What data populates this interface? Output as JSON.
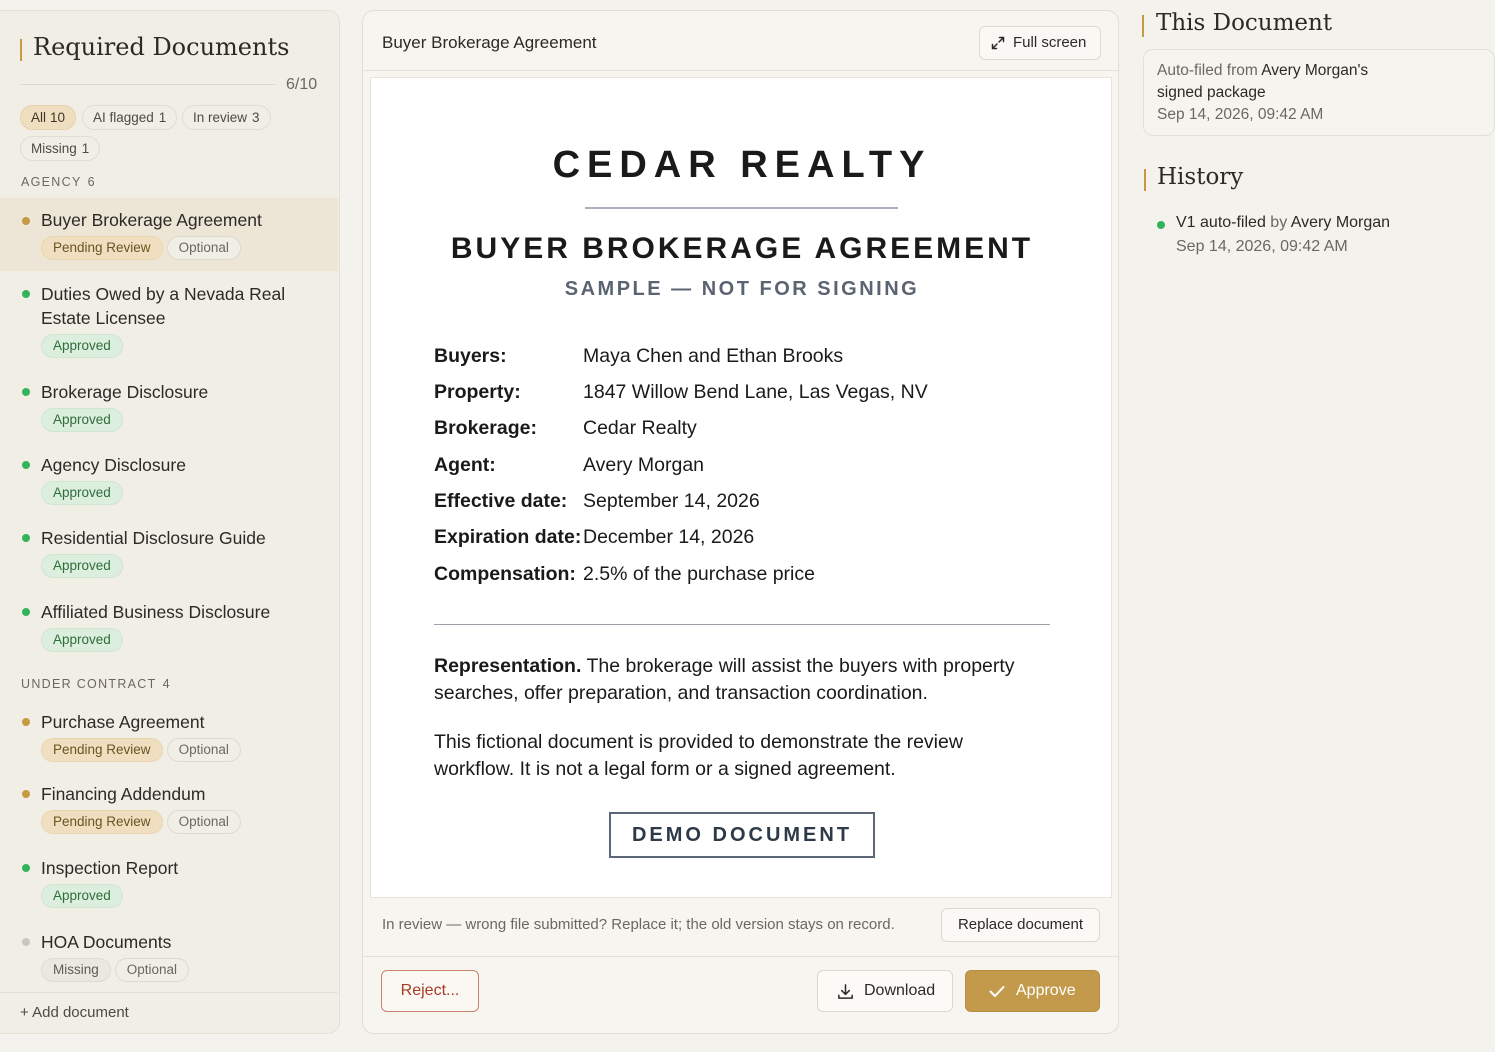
{
  "sidebar": {
    "title": "Required Documents",
    "count": "6/10",
    "filters": [
      {
        "label": "All",
        "count": "10"
      },
      {
        "label": "AI flagged",
        "count": "1"
      },
      {
        "label": "In review",
        "count": "3"
      },
      {
        "label": "Missing",
        "count": "1"
      }
    ],
    "groups": [
      {
        "label": "AGENCY",
        "count": "6"
      },
      {
        "label": "UNDER CONTRACT",
        "count": "4"
      }
    ],
    "docs": [
      {
        "title": "Buyer Brokerage Agreement",
        "status": "pending",
        "badges": [
          "Pending Review",
          "Optional"
        ]
      },
      {
        "title": "Duties Owed by a Nevada Real Estate Licensee",
        "status": "approved",
        "badges": [
          "Approved"
        ]
      },
      {
        "title": "Brokerage Disclosure",
        "status": "approved",
        "badges": [
          "Approved"
        ]
      },
      {
        "title": "Agency Disclosure",
        "status": "approved",
        "badges": [
          "Approved"
        ]
      },
      {
        "title": "Residential Disclosure Guide",
        "status": "approved",
        "badges": [
          "Approved"
        ]
      },
      {
        "title": "Affiliated Business Disclosure",
        "status": "approved",
        "badges": [
          "Approved"
        ]
      },
      {
        "title": "Purchase Agreement",
        "status": "pending",
        "badges": [
          "Pending Review",
          "Optional"
        ]
      },
      {
        "title": "Financing Addendum",
        "status": "pending",
        "badges": [
          "Pending Review",
          "Optional"
        ]
      },
      {
        "title": "Inspection Report",
        "status": "approved",
        "badges": [
          "Approved"
        ]
      },
      {
        "title": "HOA Documents",
        "status": "missing",
        "badges": [
          "Missing",
          "Optional"
        ]
      }
    ],
    "add_label": "+ Add document"
  },
  "viewer": {
    "title": "Buyer Brokerage Agreement",
    "fullscreen_label": "Full screen",
    "review_note": "In review — wrong file submitted? Replace it; the old version stays on record.",
    "replace_label": "Replace document",
    "reject_label": "Reject...",
    "download_label": "Download",
    "approve_label": "Approve"
  },
  "document": {
    "brand": "CEDAR REALTY",
    "title": "BUYER BROKERAGE AGREEMENT",
    "subtitle": "SAMPLE — NOT FOR SIGNING",
    "fields": [
      {
        "label": "Buyers:",
        "value": "Maya Chen and Ethan Brooks"
      },
      {
        "label": "Property:",
        "value": "1847 Willow Bend Lane, Las Vegas, NV"
      },
      {
        "label": "Brokerage:",
        "value": "Cedar Realty"
      },
      {
        "label": "Agent:",
        "value": "Avery Morgan"
      },
      {
        "label": "Effective date:",
        "value": "September 14, 2026"
      },
      {
        "label": "Expiration date:",
        "value": "December 14, 2026"
      },
      {
        "label": "Compensation:",
        "value": "2.5% of the purchase price"
      }
    ],
    "representation_label": "Representation.",
    "representation_text": "The brokerage will assist the buyers with property searches, offer preparation, and transaction coordination.",
    "disclaimer": "This fictional document is provided to demonstrate the review workflow. It is not a legal form or a signed agreement.",
    "stamp": "DEMO DOCUMENT"
  },
  "details": {
    "heading": "This Document",
    "source_prefix": "Auto-filed from",
    "source_name": "Avery Morgan's",
    "source_suffix": "signed package",
    "timestamp": "Sep 14, 2026, 09:42 AM",
    "history_heading": "History",
    "history": [
      {
        "version": "V1 auto-filed",
        "by": "by",
        "actor": "Avery Morgan",
        "timestamp": "Sep 14, 2026, 09:42 AM"
      }
    ]
  },
  "colors": {
    "accent": "#c59a43",
    "approved": "#33b35a",
    "pending": "#c59a43",
    "missing": "#c9c6be",
    "reject": "#a33d24",
    "approve_button": "#c39a4b"
  }
}
